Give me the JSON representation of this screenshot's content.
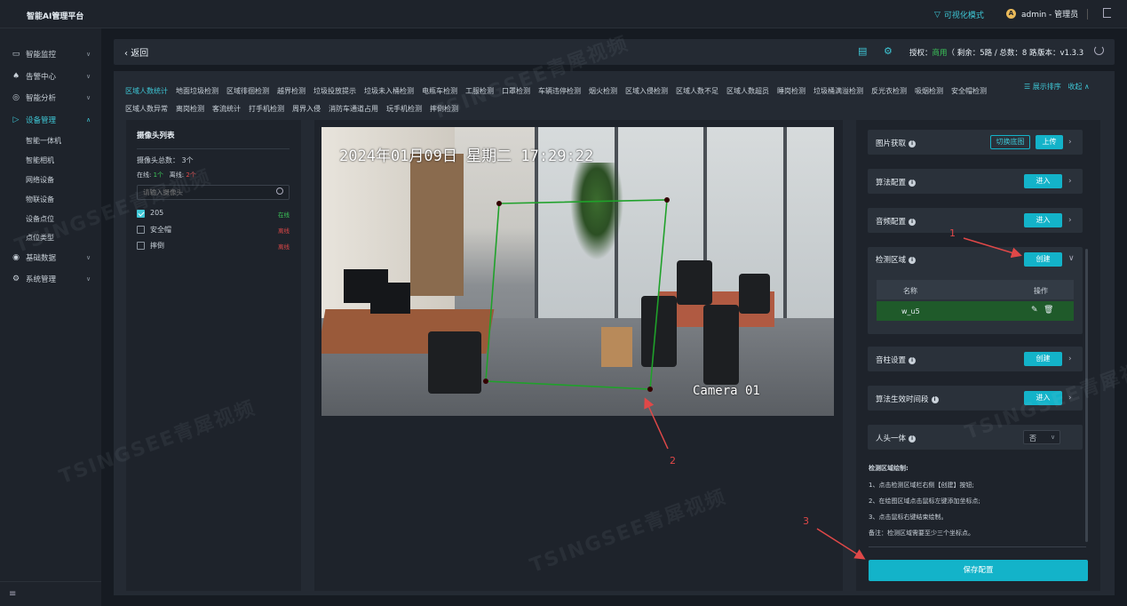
{
  "app": {
    "title": "智能AI管理平台"
  },
  "topbar": {
    "viz_mode": "可视化模式",
    "user_initial": "A",
    "user_label": "admin - 管理员"
  },
  "sidebar": {
    "items": [
      {
        "label": "智能监控",
        "icon": "monitor-icon"
      },
      {
        "label": "告警中心",
        "icon": "bell-icon"
      },
      {
        "label": "智能分析",
        "icon": "compass-icon"
      },
      {
        "label": "设备管理",
        "icon": "camera-icon"
      },
      {
        "label": "基础数据",
        "icon": "database-icon"
      },
      {
        "label": "系统管理",
        "icon": "gear-icon"
      }
    ],
    "sub_items": [
      "智能一体机",
      "智能相机",
      "网络设备",
      "物联设备",
      "设备点位",
      "点位类型"
    ],
    "collapse_icon": "≡"
  },
  "header": {
    "back": "返回",
    "auth_label": "授权：",
    "auth_status": "商用",
    "auth_detail": "（ 剩余：5路 / 总数：8 路 ）",
    "version": "版本：v1.3.3"
  },
  "tabs": {
    "items": [
      "区域人数统计",
      "地面垃圾检测",
      "区域徘徊检测",
      "越界检测",
      "垃圾投放提示",
      "垃圾未入桶检测",
      "电瓶车检测",
      "工服检测",
      "口罩检测",
      "车辆违停检测",
      "烟火检测",
      "区域入侵检测",
      "区域人数不足",
      "区域人数超员",
      "睡岗检测",
      "垃圾桶满溢检测",
      "反光衣检测",
      "吸烟检测",
      "安全帽检测",
      "区域人数异常",
      "离岗检测",
      "客流统计",
      "打手机检测",
      "周界入侵",
      "消防车通道占用",
      "玩手机检测",
      "摔倒检测"
    ],
    "sort_label": "☰ 展示排序",
    "collapse_label": "收起 ∧"
  },
  "camera_list": {
    "title": "摄像头列表",
    "total": "摄像头总数：  3个",
    "online_label": "在线:",
    "online_count": "1个",
    "offline_label": "离线:",
    "offline_count": "2个",
    "search_placeholder": "请输入摄像头",
    "cameras": [
      {
        "name": "205",
        "status": "在线",
        "checked": true
      },
      {
        "name": "安全帽",
        "status": "离线",
        "checked": false
      },
      {
        "name": "摔倒",
        "status": "离线",
        "checked": false
      }
    ]
  },
  "video": {
    "timestamp": "2024年01月09日  星期二  17:29:22",
    "camera_label": "Camera 01"
  },
  "config": {
    "image_fetch": {
      "label": "图片获取",
      "switch_btn": "切换底图",
      "upload_btn": "上传"
    },
    "algo_config": {
      "label": "算法配置",
      "btn": "进入"
    },
    "audio_config": {
      "label": "音频配置",
      "btn": "进入"
    },
    "detect_area": {
      "label": "检测区域",
      "btn": "创建",
      "col_name": "名称",
      "col_action": "操作",
      "rows": [
        {
          "name": "w_u5"
        }
      ]
    },
    "speaker": {
      "label": "音柱设置",
      "btn": "创建"
    },
    "algo_time": {
      "label": "算法生效时间段",
      "btn": "进入"
    },
    "face_body": {
      "label": "人头一体",
      "value": "否"
    },
    "help_title": "检测区域绘制:",
    "help_lines": [
      "1、点击检测区域栏右侧【创建】按钮;",
      "2、在绘图区域点击鼠标左键添加坐标点;",
      "3、点击鼠标右键结束绘制。",
      "备注：检测区域需要至少三个坐标点。"
    ],
    "save_btn": "保存配置"
  },
  "annotations": [
    "1",
    "2",
    "3"
  ],
  "watermark": "TSINGSEE青犀视频",
  "colors": {
    "accent": "#13b3c9",
    "online": "#3cc85a",
    "offline": "#e04848",
    "annotation": "#e04848",
    "polygon": "#1fa12a"
  }
}
